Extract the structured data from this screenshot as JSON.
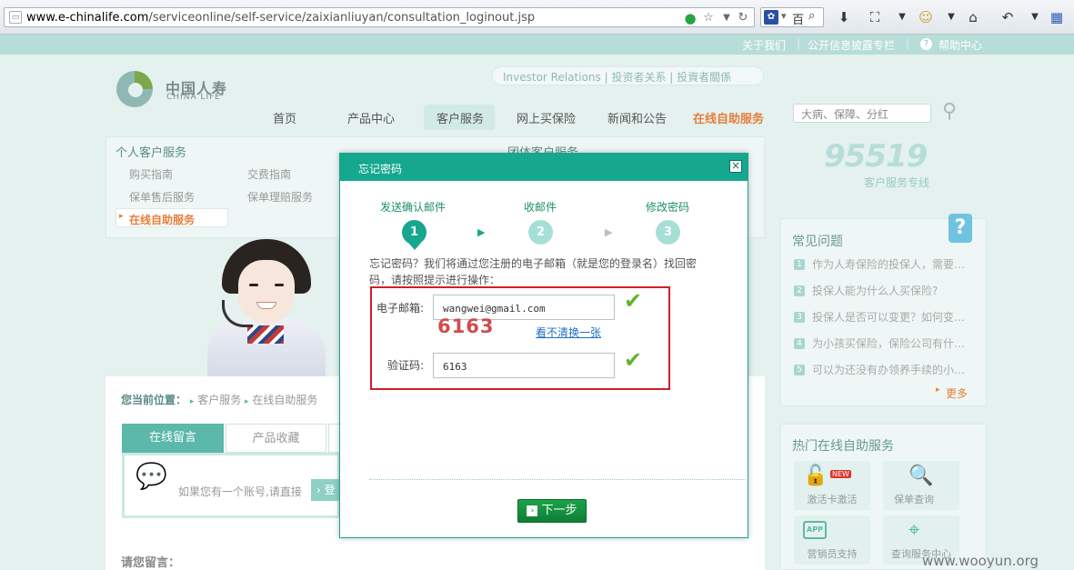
{
  "browser": {
    "url_host": "www.e-chinalife.com",
    "url_path": "/serviceonline/self-service/zaixianliuyan/consultation_loginout.jsp",
    "search_engine_glyph": "百"
  },
  "top_links": [
    "关于我们",
    "公开信息披露专栏",
    "帮助中心"
  ],
  "logo": {
    "cn": "中国人寿",
    "en": "CHINA LIFE"
  },
  "investor_relations": "Investor Relations | 投资者关系 | 投資者關係",
  "nav": {
    "items": [
      "首页",
      "产品中心",
      "客户服务",
      "网上买保险",
      "新闻和公告",
      "在线自助服务"
    ],
    "active_index": 2,
    "highlight_color": "#e67e3b"
  },
  "site_search_placeholder": "大病、保障、分红",
  "menu": {
    "personal_title": "个人客户服务",
    "group_title": "团体客户服务",
    "items": [
      "购买指南",
      "交费指南",
      "保单售后服务",
      "保单理赔服务",
      "在线自助服务"
    ]
  },
  "hotline": {
    "number": "95519",
    "label": "客户服务专线"
  },
  "faq": {
    "title": "常见问题",
    "items": [
      "作为人寿保险的投保人，需要…",
      "投保人能为什么人买保险?",
      "投保人是否可以变更？如何变…",
      "为小孩买保险，保险公司有什…",
      "可以为还没有办领养手续的小…"
    ],
    "more": "更多"
  },
  "hot_services": {
    "title": "热门在线自助服务",
    "items": [
      "激活卡激活",
      "保单查询",
      "营销员支持",
      "查询服务中心"
    ],
    "new_badge": "NEW"
  },
  "breadcrumb": {
    "label": "您当前位置：",
    "items": [
      "客户服务",
      "在线自助服务"
    ]
  },
  "tabs": [
    "在线留言",
    "产品收藏"
  ],
  "message_prompt": "如果您有一个账号,请直接",
  "login_button_fragment": "登",
  "leave_message_title": "请您留言：",
  "modal": {
    "title": "忘记密码",
    "steps": [
      {
        "label": "发送确认邮件",
        "num": "1"
      },
      {
        "label": "收邮件",
        "num": "2"
      },
      {
        "label": "修改密码",
        "num": "3"
      }
    ],
    "description": "忘记密码？我们将通过您注册的电子邮箱（就是您的登录名）找回密码，请按照提示进行操作：",
    "email_label": "电子邮箱:",
    "email_value": "wangwei@gmail.com",
    "captcha_image_text": "6163",
    "captcha_refresh": "看不清换一张",
    "captcha_label": "验证码:",
    "captcha_value": "6163",
    "next_button": "下一步"
  },
  "watermark": "www.wooyun.org",
  "colors": {
    "brand": "#16a78f",
    "accent_orange": "#e67e3b",
    "error_border": "#d21e25"
  }
}
